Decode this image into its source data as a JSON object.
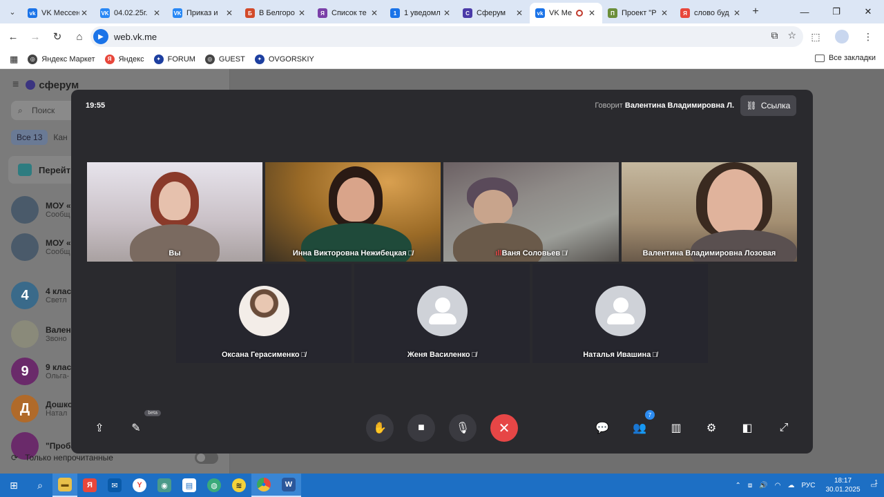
{
  "browser": {
    "tabs": [
      {
        "label": "VK Мессен",
        "fav": "vk",
        "color": "#1a73e8",
        "active": false
      },
      {
        "label": "04.02.25г.",
        "fav": "VK",
        "color": "#2787f5",
        "active": false
      },
      {
        "label": "Приказ и",
        "fav": "VK",
        "color": "#2787f5",
        "active": false
      },
      {
        "label": "В Белгоро",
        "fav": "Б",
        "color": "#d24a2a",
        "active": false
      },
      {
        "label": "Список те",
        "fav": "Я",
        "color": "#7a3fa8",
        "active": false
      },
      {
        "label": "1 уведомл",
        "fav": "1",
        "color": "#1a73e8",
        "active": false
      },
      {
        "label": "Сферум",
        "fav": "С",
        "color": "#4a3aa8",
        "active": false
      },
      {
        "label": "VK Ме",
        "fav": "vk",
        "color": "#1a73e8",
        "active": true
      },
      {
        "label": "Проект \"Р",
        "fav": "П",
        "color": "#6b8e3a",
        "active": false
      },
      {
        "label": "слово буд",
        "fav": "Я",
        "color": "#e8473b",
        "active": false
      }
    ],
    "url": "web.vk.me",
    "bookmarks": [
      {
        "label": "Яндекс Маркет",
        "color": "#444",
        "glyph": "◎"
      },
      {
        "label": "Яндекс",
        "color": "#e8473b",
        "glyph": "Я"
      },
      {
        "label": "FORUM",
        "color": "#1d3fa0",
        "glyph": "✦"
      },
      {
        "label": "GUEST",
        "color": "#444",
        "glyph": "◎"
      },
      {
        "label": "OVGORSKIY",
        "color": "#1d3fa0",
        "glyph": "✦"
      }
    ],
    "all_bookmarks": "Все закладки"
  },
  "sidebar": {
    "app_name": "сферум",
    "search_placeholder": "Поиск",
    "filter_all": "Все",
    "filter_all_count": "13",
    "filter_next": "Кан",
    "banner": "Перейт",
    "chats": [
      {
        "name": "МОУ «",
        "sub": "Сообщ",
        "color": "#4a5a6a",
        "glyph": ""
      },
      {
        "name": "МОУ «",
        "sub": "Сообщ",
        "color": "#4a5a6a",
        "glyph": ""
      },
      {
        "name": "4 клас",
        "sub": "Светл",
        "color": "#3a6a8a",
        "glyph": "4"
      },
      {
        "name": "Вален",
        "sub": "Звоно",
        "color": "#8a8a7a",
        "glyph": ""
      },
      {
        "name": "9 клас",
        "sub": "Ольга-",
        "color": "#6a2a6a",
        "glyph": "9"
      },
      {
        "name": "Дошко",
        "sub": "Натал",
        "color": "#b06a2a",
        "glyph": "Д"
      },
      {
        "name": "\"Проба",
        "sub": "",
        "color": "#6a2a6a",
        "glyph": ""
      }
    ],
    "unread_only": "Только непрочитанные"
  },
  "call": {
    "time": "19:55",
    "speaking_prefix": "Говорит",
    "speaking_name": "Валентина Владимировна Л.",
    "link_label": "Ссылка",
    "participants_count": "7",
    "beta_label": "beta",
    "tiles_top": [
      {
        "name": "Вы",
        "muted": false
      },
      {
        "name": "Инна Викторовна Нежибецкая",
        "muted": true
      },
      {
        "name": "Ваня Соловьев",
        "muted": true
      },
      {
        "name": "Валентина Владимировна Лозовая",
        "muted": false
      }
    ],
    "tiles_bottom": [
      {
        "name": "Оксана Герасименко",
        "muted": true
      },
      {
        "name": "Женя Василенко",
        "muted": true
      },
      {
        "name": "Наталья Ивашина",
        "muted": true
      }
    ]
  },
  "taskbar": {
    "lang": "РУС",
    "time": "18:17",
    "date": "30.01.2025",
    "notif_count": "1"
  }
}
